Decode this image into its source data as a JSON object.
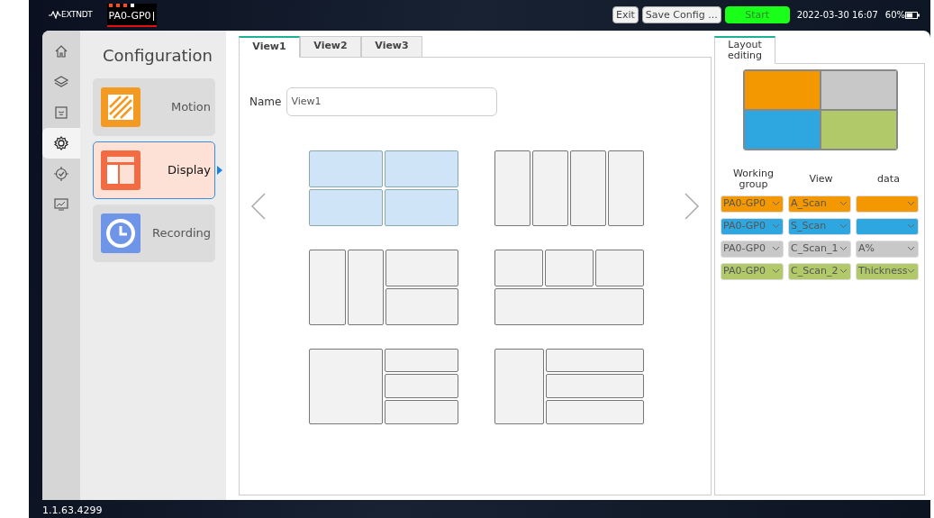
{
  "top_bar": {
    "logo": "EXTNDT",
    "group_tab": {
      "label": "PA0-GP0",
      "dots": [
        {
          "color": "#ff4a1c"
        },
        {
          "color": "#ff4a1c"
        },
        {
          "color": "#ff4a1c"
        },
        {
          "color": "#ffffff"
        }
      ]
    },
    "buttons": [
      {
        "label": "Exit",
        "kind": "plain"
      },
      {
        "label": "Save Config ...",
        "kind": "plain"
      },
      {
        "label": "Start",
        "kind": "start"
      }
    ],
    "datetime": "2022-03-30 16:07",
    "battery": "60%"
  },
  "rail": [
    {
      "kind": "home",
      "selected": false
    },
    {
      "kind": "layers",
      "selected": false
    },
    {
      "kind": "probe",
      "selected": false
    },
    {
      "kind": "settings",
      "selected": true
    },
    {
      "kind": "target",
      "selected": false
    },
    {
      "kind": "monitor",
      "selected": false
    }
  ],
  "configuration": {
    "title": "Configuration",
    "items": [
      {
        "label": "Motion",
        "kind": "motion",
        "selected": false
      },
      {
        "label": "Display",
        "kind": "display",
        "selected": true
      },
      {
        "label": "Recording",
        "kind": "recording",
        "selected": false
      }
    ]
  },
  "view_tabs": [
    {
      "label": "View1",
      "selected": true
    },
    {
      "label": "View2",
      "selected": false
    },
    {
      "label": "View3",
      "selected": false
    }
  ],
  "name_field": {
    "label": "Name",
    "value": "View1"
  },
  "layouts": [
    {
      "kind": "quad",
      "selected": true
    },
    {
      "kind": "four-columns",
      "selected": false
    },
    {
      "kind": "two-columns-two-rows",
      "selected": false
    },
    {
      "kind": "three-top-one-bottom",
      "selected": false
    },
    {
      "kind": "wide-left-three-rows",
      "selected": false
    },
    {
      "kind": "narrow-left-three-rows",
      "selected": false
    }
  ],
  "layout_editing": {
    "tab": "Layout editing",
    "preview": [
      {
        "color": "#f39800"
      },
      {
        "color": "#c8c8c8"
      },
      {
        "color": "#2ea7e0"
      },
      {
        "color": "#b2c96a"
      }
    ],
    "columns": [
      "Working group",
      "View",
      "data"
    ],
    "rows": [
      {
        "color": "#f39800",
        "cells": [
          "PA0-GP0",
          "A_Scan",
          ""
        ]
      },
      {
        "color": "#2ea7e0",
        "cells": [
          "PA0-GP0",
          "S_Scan",
          ""
        ]
      },
      {
        "color": "#c8c8c8",
        "cells": [
          "PA0-GP0",
          "C_Scan_1",
          "A%"
        ]
      },
      {
        "color": "#b2c96a",
        "cells": [
          "PA0-GP0",
          "C_Scan_2",
          "Thickness"
        ]
      }
    ]
  },
  "version": "1.1.63.4299"
}
